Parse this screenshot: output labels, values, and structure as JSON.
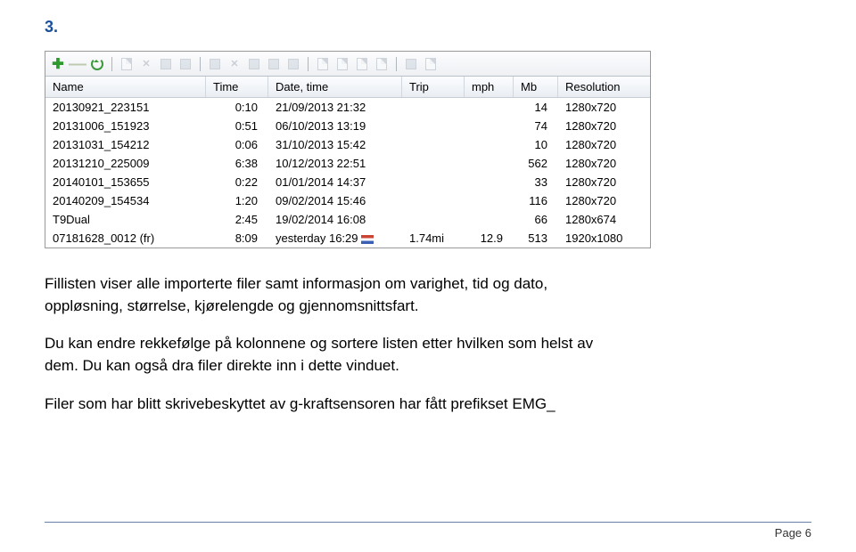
{
  "heading_number": "3.",
  "table": {
    "headers": {
      "name": "Name",
      "time": "Time",
      "date": "Date, time",
      "trip": "Trip",
      "mph": "mph",
      "mb": "Mb",
      "res": "Resolution"
    },
    "rows": [
      {
        "name": "20130921_223151",
        "time": "0:10",
        "date": "21/09/2013 21:32",
        "trip": "",
        "mph": "",
        "mb": "14",
        "res": "1280x720"
      },
      {
        "name": "20131006_151923",
        "time": "0:51",
        "date": "06/10/2013 13:19",
        "trip": "",
        "mph": "",
        "mb": "74",
        "res": "1280x720"
      },
      {
        "name": "20131031_154212",
        "time": "0:06",
        "date": "31/10/2013 15:42",
        "trip": "",
        "mph": "",
        "mb": "10",
        "res": "1280x720"
      },
      {
        "name": "20131210_225009",
        "time": "6:38",
        "date": "10/12/2013 22:51",
        "trip": "",
        "mph": "",
        "mb": "562",
        "res": "1280x720"
      },
      {
        "name": "20140101_153655",
        "time": "0:22",
        "date": "01/01/2014 14:37",
        "trip": "",
        "mph": "",
        "mb": "33",
        "res": "1280x720"
      },
      {
        "name": "20140209_154534",
        "time": "1:20",
        "date": "09/02/2014 15:46",
        "trip": "",
        "mph": "",
        "mb": "116",
        "res": "1280x720"
      },
      {
        "name": "T9Dual",
        "time": "2:45",
        "date": "19/02/2014 16:08",
        "trip": "",
        "mph": "",
        "mb": "66",
        "res": "1280x674"
      },
      {
        "name": "07181628_0012 (fr)",
        "time": "8:09",
        "date": "yesterday 16:29",
        "trip": "1.74mi",
        "mph": "12.9",
        "mb": "513",
        "res": "1920x1080",
        "flag": true
      }
    ]
  },
  "paragraphs": {
    "p1": "Fillisten viser alle importerte filer samt informasjon om varighet, tid og dato, oppløsning, størrelse, kjørelengde og gjennomsnittsfart.",
    "p2": "Du kan endre rekkefølge på kolonnene og sortere listen etter hvilken som helst av dem. Du kan også dra filer direkte inn i dette vinduet.",
    "p3": "Filer som har blitt skrivebeskyttet av g-kraftsensoren har fått prefikset EMG_"
  },
  "footer": {
    "page_label": "Page 6"
  }
}
